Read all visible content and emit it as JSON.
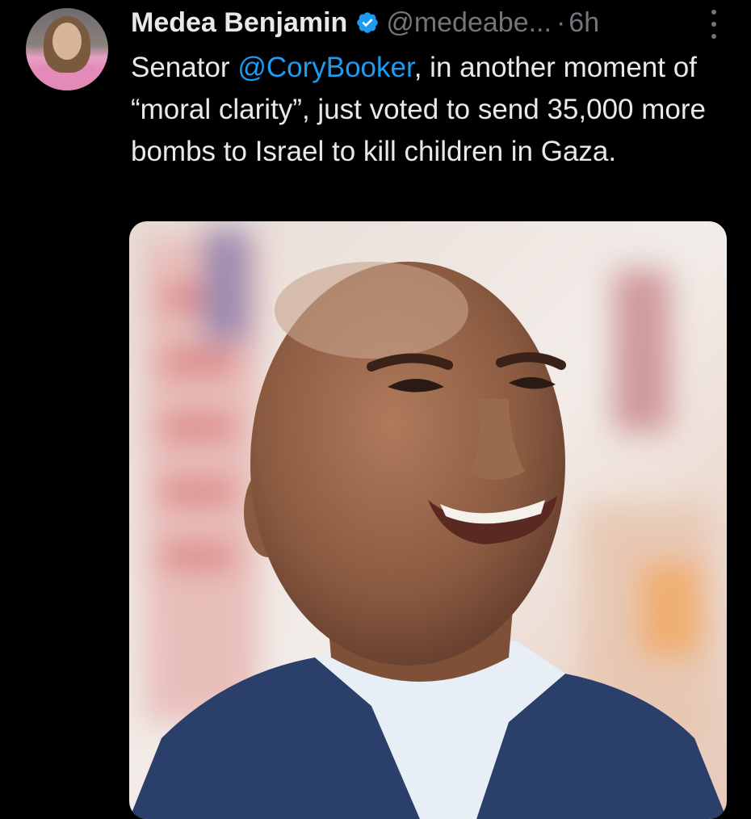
{
  "tweet": {
    "author_name": "Medea Benjamin",
    "author_handle": "@medeabe...",
    "separator": "·",
    "time": "6h",
    "text_before": "Senator ",
    "mention": "@CoryBooker",
    "text_after": ", in another moment of “moral clarity”, just voted to send 35,000 more bombs to Israel to kill children in Gaza.",
    "verified_icon": "verified-badge-icon",
    "more_icon": "more-options-icon"
  },
  "colors": {
    "background": "#000000",
    "text": "#e7e9ea",
    "secondary": "#71767b",
    "link": "#1d9bf0",
    "verified": "#1d9bf0"
  }
}
